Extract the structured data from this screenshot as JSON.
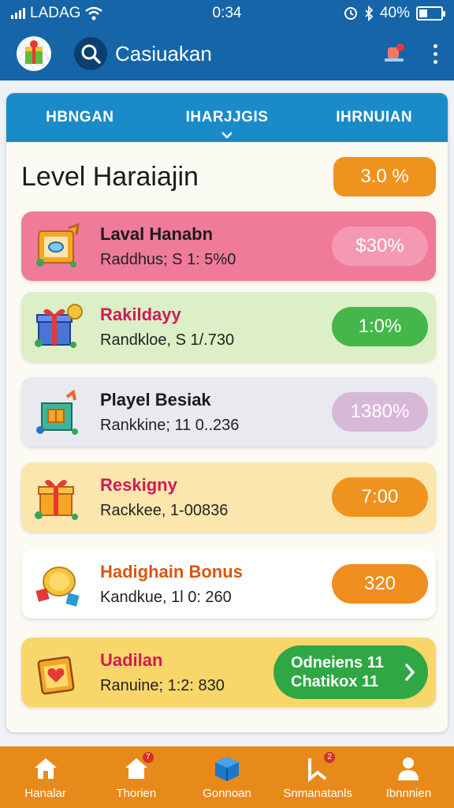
{
  "status_bar": {
    "carrier": "LADAG",
    "time": "0:34",
    "battery": "40%",
    "battery_level": 0.4
  },
  "app_bar": {
    "title": "Casiuakan"
  },
  "tabs": [
    {
      "label": "HBNGAN",
      "active": false
    },
    {
      "label": "IHARJJGIS",
      "active": true
    },
    {
      "label": "IHRNUIAN",
      "active": false
    }
  ],
  "section": {
    "title": "Level Haraiajin",
    "value": "3.0 %"
  },
  "rows": [
    {
      "name": "Laval Hanabn",
      "sub": "Raddhus; S 1: 5%0",
      "value": "$30%",
      "name_color": "#1b1b1b",
      "bg": "#f07a9a",
      "pill": "#f599b2",
      "icon": "frame-icon"
    },
    {
      "name": "Rakildayy",
      "sub": "Randkloe, S 1/.730",
      "value": "1:0%",
      "name_color": "#d11a5a",
      "bg": "#dcefc6",
      "pill": "#45b649",
      "icon": "gift-box-icon"
    },
    {
      "name": "Playel Besiak",
      "sub": "Rankkine; 11 0..236",
      "value": "1380%",
      "name_color": "#1b1b1b",
      "bg": "#e8eaf0",
      "pill": "#d7b8d8",
      "icon": "gift-house-icon"
    },
    {
      "name": "Reskigny",
      "sub": "Rackkee, 1-00836",
      "value": "7:00",
      "name_color": "#d11a5a",
      "bg": "#fbe6ad",
      "pill": "#f0931e",
      "icon": "gift-box-icon"
    },
    {
      "name": "Hadighain Bonus",
      "sub": "Kandkue, 1l 0: 260",
      "value": "320",
      "name_color": "#d9560c",
      "bg": "#ffffff",
      "pill": "#ef8e1e",
      "icon": "coins-icon"
    },
    {
      "name": "Uadilan",
      "sub": "Ranuine; 1:2: 830",
      "value_lines": [
        "Odneiens 11",
        "Chatikox 11"
      ],
      "name_color": "#d11a5a",
      "bg": "#f9d66a",
      "pill": "#2fa744",
      "icon": "heart-card-icon"
    }
  ],
  "bottom_nav": [
    {
      "label": "Hanalar",
      "icon": "home-icon",
      "badge": ""
    },
    {
      "label": "Thorien",
      "icon": "house-badge-icon",
      "badge": "7"
    },
    {
      "label": "Gonnoan",
      "icon": "cube-icon",
      "badge": ""
    },
    {
      "label": "Snmanatanls",
      "icon": "bookmark-badge-icon",
      "badge": "2"
    },
    {
      "label": "Ibnnnien",
      "icon": "profile-icon",
      "badge": ""
    }
  ],
  "colors": {
    "primary": "#1565a8",
    "tab_bar": "#1a8bc9",
    "accent_orange": "#e88a1a"
  }
}
